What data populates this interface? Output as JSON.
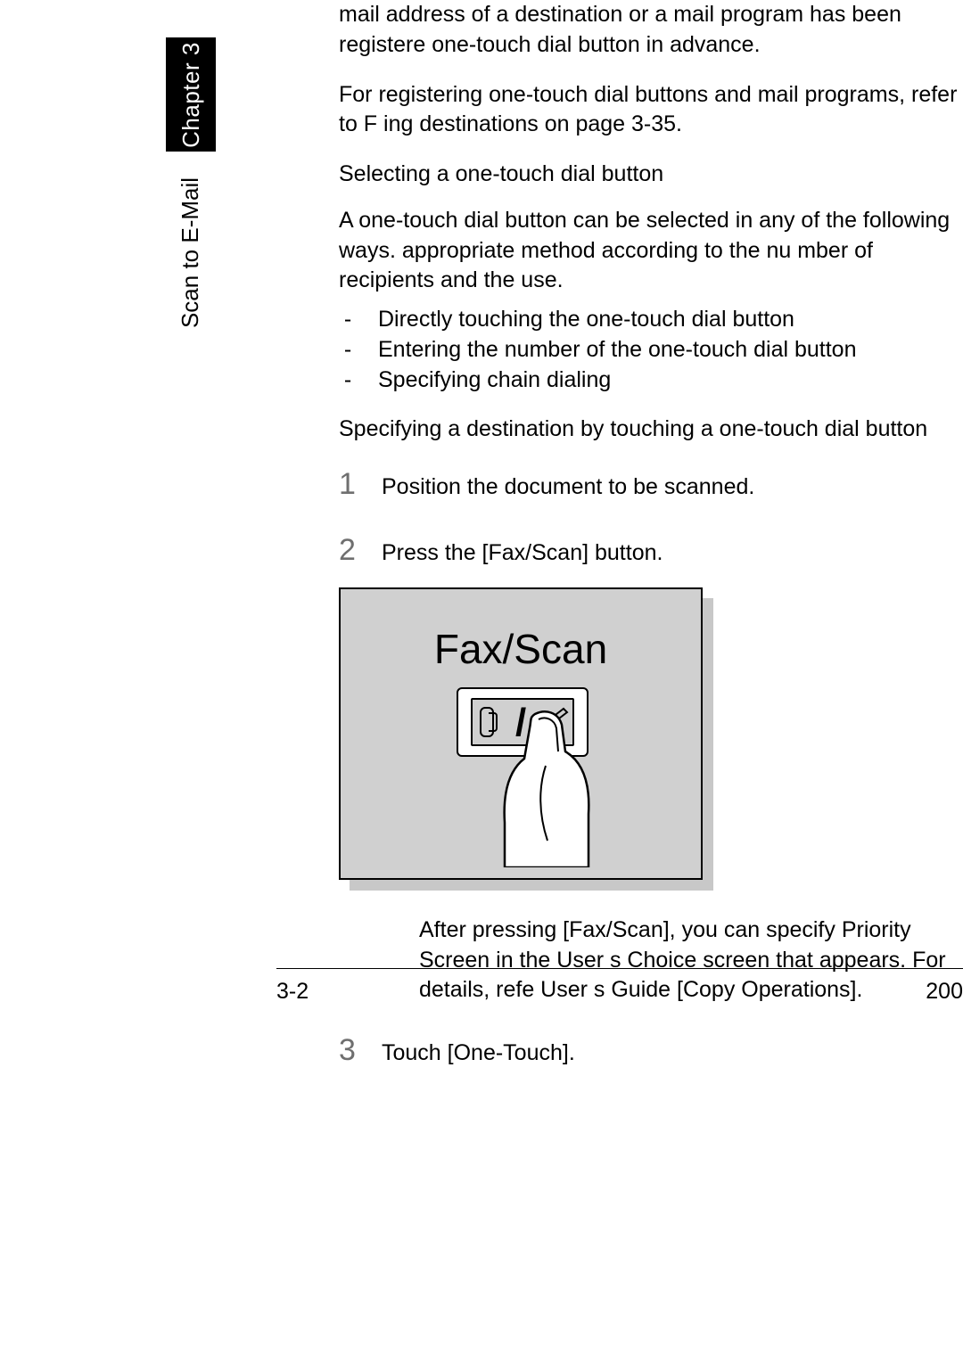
{
  "side": {
    "chapter_label": "Chapter 3",
    "section_label": "Scan to E-Mail"
  },
  "body": {
    "p1": "mail address of a destination or a mail program has been registere one-touch dial button in advance.",
    "p2": "For registering one-touch dial buttons and mail programs, refer to  F ing destinations  on page 3-35.",
    "h1": "Selecting a one-touch dial button",
    "p3": "A one-touch dial button can be selected in any of the following ways. appropriate method according to the nu mber of recipients and the use.",
    "bullets": [
      "Directly touching the one-touch dial button",
      "Entering the number of the one-touch dial button",
      "Specifying chain dialing"
    ],
    "h2": "Specifying a destination by touching a one-touch dial button",
    "steps": {
      "s1_num": "1",
      "s1_text": "Position the document to be scanned.",
      "s2_num": "2",
      "s2_text": "Press the [Fax/Scan] button.",
      "s3_num": "3",
      "s3_text": "Touch [One-Touch]."
    },
    "figure_label": "Fax/Scan",
    "note": "After pressing [Fax/Scan], you can specify Priority Screen in the User s Choice screen that appears. For details, refe User s Guide [Copy Operations]."
  },
  "footer": {
    "left": "3-2",
    "right": "200"
  }
}
